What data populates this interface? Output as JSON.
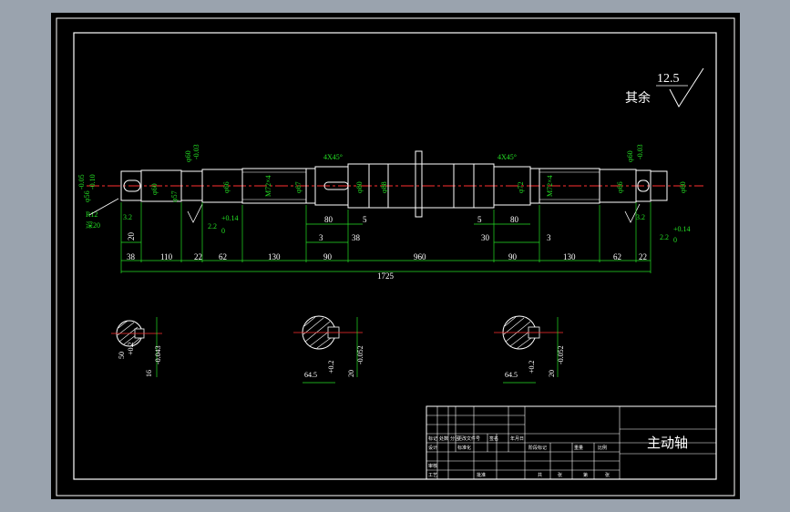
{
  "roughness": {
    "label": "其余",
    "value": "12.5"
  },
  "chamfers": {
    "left": "4X45°",
    "right": "4X45°"
  },
  "shaft_labels": {
    "d56": "φ56",
    "d56_tol_top": "-0.05",
    "d56_tol_bot": "-0.10",
    "d60_a": "φ60",
    "d60_tol": "-0.03",
    "d60_b": "φ60",
    "d57": "φ57",
    "d66": "φ66",
    "spline_l": "M72×4",
    "d67": "φ67",
    "d80": "φ80",
    "d88": "φ88",
    "d72": "φ72",
    "spline_r": "M72×4",
    "d66_r": "φ66",
    "d60_r": "φ60",
    "d60_r_tol": "-0.03",
    "d60_end": "φ60",
    "r12": "R12",
    "slot": "深20",
    "r32_l": "3.2",
    "r32_r": "3.2",
    "keydepth_l": "2.2",
    "keydepth_l_tol": "+0.14",
    "keydepth_l_low": "0",
    "keydepth_r": "2.2",
    "keydepth_r_tol": "+0.14",
    "keydepth_r_low": "0"
  },
  "dimensions": {
    "upper": [
      "20",
      "80",
      "5",
      "5",
      "80"
    ],
    "mid": [
      "3",
      "38",
      "30",
      "3"
    ],
    "lower": [
      "38",
      "110",
      "22",
      "62",
      "130",
      "90",
      "960",
      "90",
      "130",
      "62",
      "22"
    ],
    "total": "1725"
  },
  "sections": [
    {
      "width": "16",
      "width_tol": "-0.043",
      "depth": "50",
      "depth_tol": "+0.2"
    },
    {
      "width": "20",
      "width_tol": "-0.052",
      "depth": "64.5",
      "depth_tol": "+0.2"
    },
    {
      "width": "20",
      "width_tol": "-0.052",
      "depth": "64.5",
      "depth_tol": "+0.2"
    }
  ],
  "title_block": {
    "part_name": "主动轴",
    "rows": [
      "标记",
      "处数",
      "分区",
      "更改文件号",
      "签名",
      "年月日"
    ],
    "labels": [
      "设计",
      "标准化",
      "阶段标记",
      "重量",
      "比例",
      "审核",
      "工艺",
      "批准",
      "共",
      "张",
      "第",
      "张"
    ]
  },
  "colors": {
    "background": "#000000",
    "frame": "#ffffff",
    "geometry": "#ffffff",
    "dimension": "#24e024",
    "centerline": "#ff3030",
    "hatch": "#ffffff"
  }
}
